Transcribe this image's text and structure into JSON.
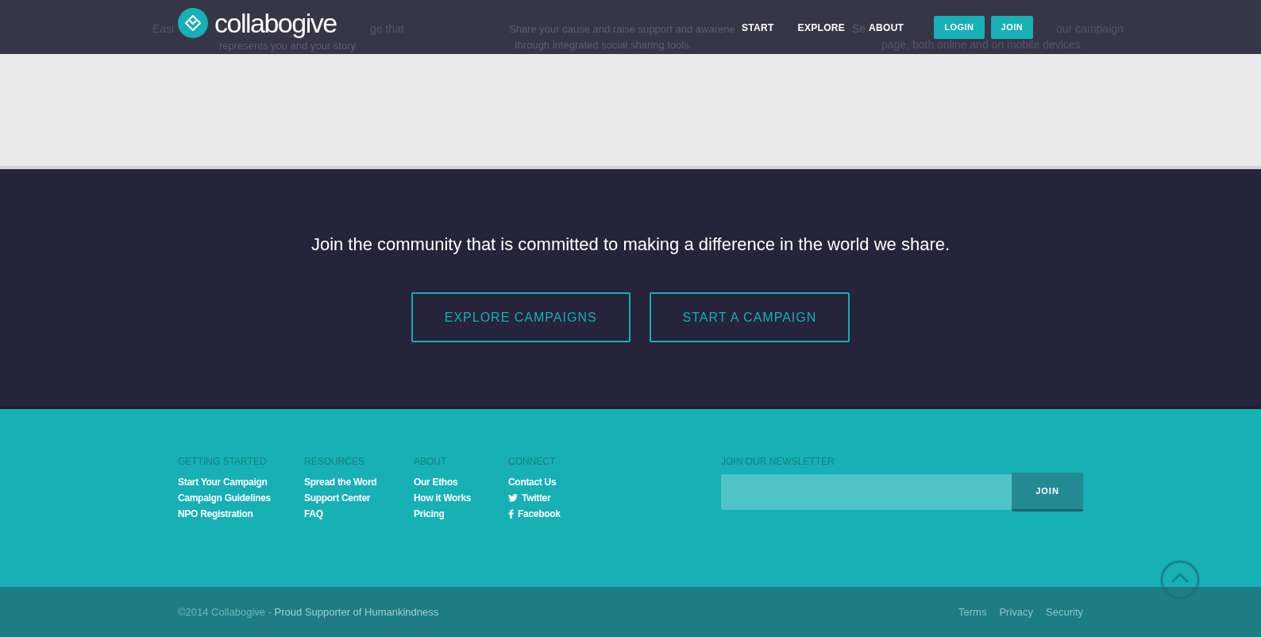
{
  "header": {
    "logo_text": "collabogive",
    "nav": [
      {
        "label": "START",
        "kind": "link"
      },
      {
        "label": "EXPLORE",
        "kind": "link"
      },
      {
        "label": "ABOUT",
        "kind": "link"
      },
      {
        "label": "LOGIN",
        "kind": "button"
      },
      {
        "label": "JOIN",
        "kind": "button"
      }
    ],
    "background_fragments": [
      [
        "Easi",
        "ge that",
        "represents you and your story"
      ],
      [
        "Share your cause and raise support and awarene",
        "through integrated social sharing tools."
      ],
      [
        "Se",
        "our campaign",
        "page, both online and on mobile devices."
      ]
    ]
  },
  "cta": {
    "heading": "Join the community that is committed to making a difference in the world we share.",
    "buttons": [
      "EXPLORE CAMPAIGNS",
      "START A CAMPAIGN"
    ]
  },
  "footer": {
    "columns": [
      {
        "title": "GETTING STARTED",
        "links": [
          {
            "label": "Start Your Campaign"
          },
          {
            "label": "Campaign Guidelines"
          },
          {
            "label": "NPO Registration"
          }
        ]
      },
      {
        "title": "RESOURCES",
        "links": [
          {
            "label": "Spread the Word"
          },
          {
            "label": "Support Center"
          },
          {
            "label": "FAQ"
          }
        ]
      },
      {
        "title": "ABOUT",
        "links": [
          {
            "label": "Our Ethos"
          },
          {
            "label": "How it Works"
          },
          {
            "label": "Pricing"
          }
        ]
      },
      {
        "title": "CONNECT",
        "links": [
          {
            "label": "Contact Us",
            "kind": "plain"
          },
          {
            "label": "Twitter",
            "kind": "bird"
          },
          {
            "label": "Facebook",
            "kind": "letter"
          }
        ]
      }
    ],
    "newsletter": {
      "title": "JOIN OUR NEWSLETTER",
      "button": "JOIN"
    }
  },
  "bottom_bar": {
    "copyright": "©2014 Collabogive - ",
    "tagline": "Proud Supporter of Humankindness",
    "links": [
      "Terms",
      "Privacy",
      "Security"
    ]
  }
}
